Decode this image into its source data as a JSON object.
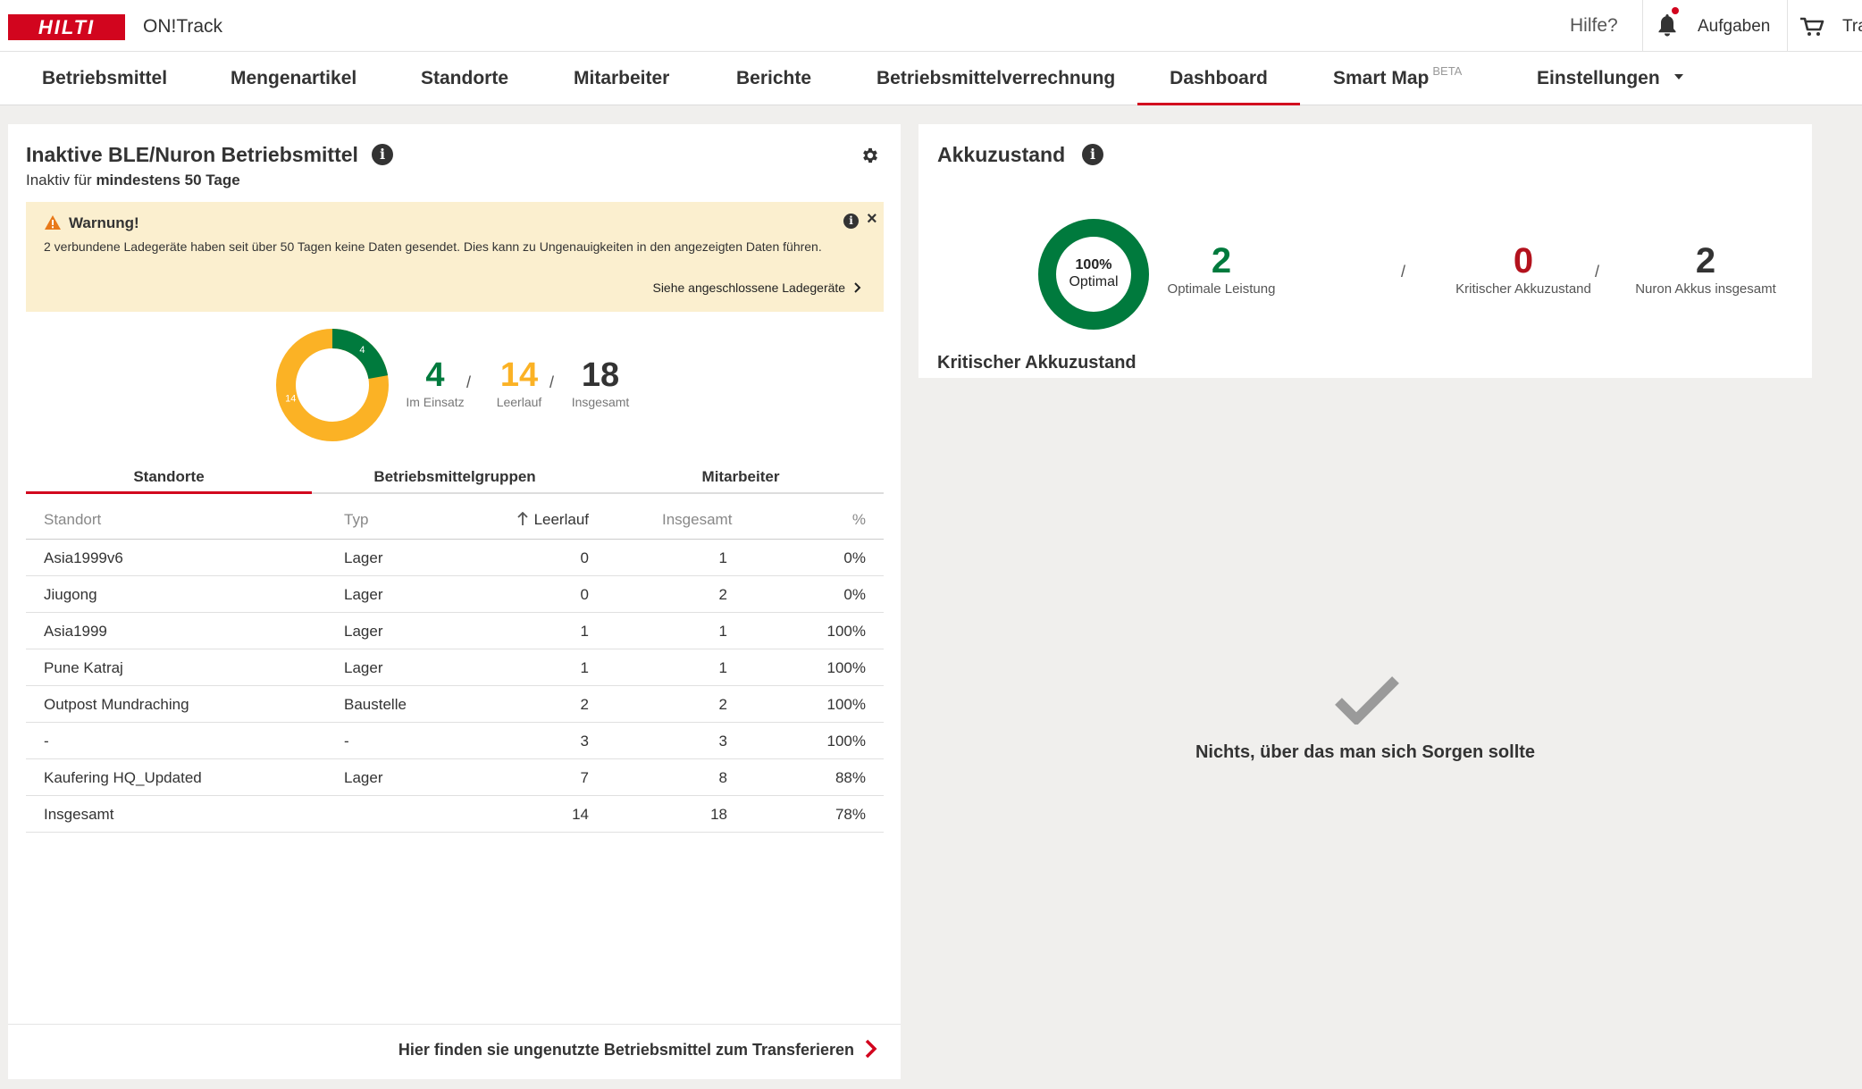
{
  "header": {
    "logo_text": "HILTI",
    "app_name": "ON!Track",
    "help": "Hilfe?",
    "tasks": "Aufgaben",
    "cart_label": "Tra"
  },
  "nav": {
    "items": [
      {
        "label": "Betriebsmittel"
      },
      {
        "label": "Mengenartikel"
      },
      {
        "label": "Standorte"
      },
      {
        "label": "Mitarbeiter"
      },
      {
        "label": "Berichte"
      },
      {
        "label": "Betriebsmittelverrechnung"
      },
      {
        "label": "Dashboard",
        "active": true
      },
      {
        "label": "Smart Map",
        "badge": "BETA"
      },
      {
        "label": "Einstellungen"
      }
    ]
  },
  "inactive": {
    "title": "Inaktive BLE/Nuron Betriebsmittel",
    "subtitle_prefix": "Inaktiv für",
    "subtitle_bold": "mindestens 50 Tage",
    "warning": {
      "title": "Warnung!",
      "text": "2 verbundene Ladegeräte haben seit über 50 Tagen keine Daten gesendet. Dies kann zu Ungenauigkeiten in den angezeigten Daten führen.",
      "link": "Siehe angeschlossene Ladegeräte"
    },
    "donut": {
      "in_use": 4,
      "idle": 14,
      "total": 18,
      "in_use_label": "4",
      "idle_label": "14"
    },
    "stats": {
      "in_use": {
        "value": "4",
        "label": "Im Einsatz"
      },
      "idle": {
        "value": "14",
        "label": "Leerlauf"
      },
      "total": {
        "value": "18",
        "label": "Insgesamt"
      }
    },
    "tabs": [
      "Standorte",
      "Betriebsmittelgruppen",
      "Mitarbeiter"
    ],
    "table": {
      "headers": [
        "Standort",
        "Typ",
        "Leerlauf",
        "Insgesamt",
        "%"
      ],
      "rows": [
        [
          "Asia1999v6",
          "Lager",
          "0",
          "1",
          "0%"
        ],
        [
          "Jiugong",
          "Lager",
          "0",
          "2",
          "0%"
        ],
        [
          "Asia1999",
          "Lager",
          "1",
          "1",
          "100%"
        ],
        [
          "Pune Katraj",
          "Lager",
          "1",
          "1",
          "100%"
        ],
        [
          "Outpost Mundraching",
          "Baustelle",
          "2",
          "2",
          "100%"
        ],
        [
          "-",
          "-",
          "3",
          "3",
          "100%"
        ],
        [
          "Kaufering HQ_Updated",
          "Lager",
          "7",
          "8",
          "88%"
        ],
        [
          "Insgesamt",
          "",
          "14",
          "18",
          "78%"
        ]
      ]
    },
    "footer_link": "Hier finden sie ungenutzte Betriebsmittel zum Transferieren"
  },
  "battery": {
    "title": "Akkuzustand",
    "donut": {
      "percent": "100%",
      "label": "Optimal",
      "optimal_fraction": 1.0
    },
    "stats": {
      "optimal": {
        "value": "2",
        "label": "Optimale Leistung"
      },
      "critical": {
        "value": "0",
        "label": "Kritischer Akkuzustand"
      },
      "total": {
        "value": "2",
        "label": "Nuron Akkus insgesamt"
      }
    },
    "critical_heading": "Kritischer Akkuzustand",
    "empty_text": "Nichts, über das man sich Sorgen sollte"
  },
  "colors": {
    "brand": "#d2051e",
    "green": "#007a3d",
    "amber": "#fbb225",
    "critical": "#b3121d"
  }
}
